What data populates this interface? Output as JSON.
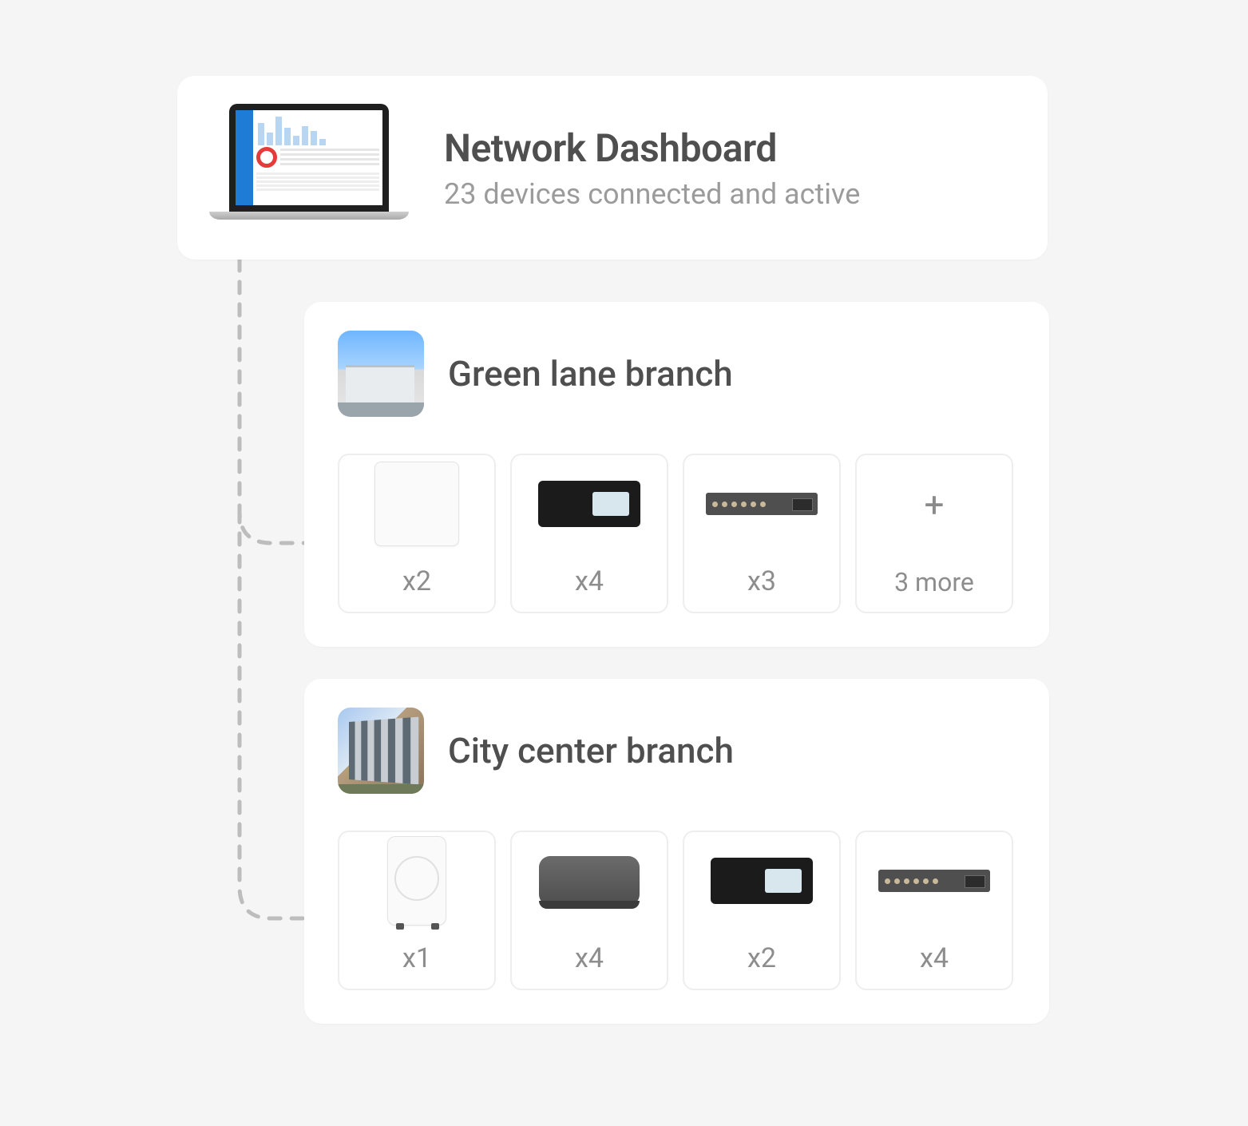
{
  "dashboard": {
    "title": "Network Dashboard",
    "subtitle": "23 devices connected and active"
  },
  "branches": [
    {
      "name": "Green lane branch",
      "devices": [
        {
          "type": "panel",
          "count_label": "x2"
        },
        {
          "type": "router-black",
          "count_label": "x4"
        },
        {
          "type": "switch",
          "count_label": "x3"
        }
      ],
      "more": {
        "icon": "+",
        "label": "3 more"
      }
    },
    {
      "name": "City center branch",
      "devices": [
        {
          "type": "sensor",
          "count_label": "x1"
        },
        {
          "type": "hub",
          "count_label": "x4"
        },
        {
          "type": "router-black",
          "count_label": "x2"
        },
        {
          "type": "switch",
          "count_label": "x4"
        }
      ]
    }
  ]
}
